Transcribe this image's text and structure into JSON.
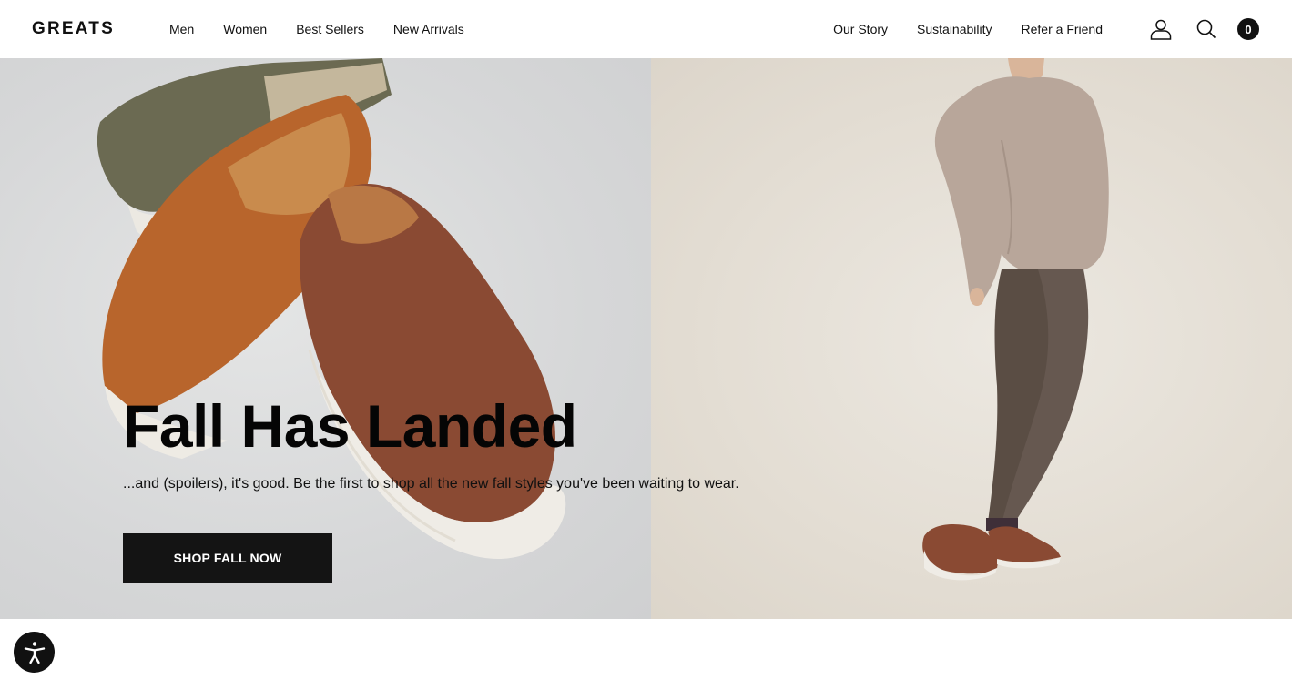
{
  "brand": {
    "logo_text": "GREATS"
  },
  "nav": {
    "left": [
      {
        "label": "Men"
      },
      {
        "label": "Women"
      },
      {
        "label": "Best Sellers"
      },
      {
        "label": "New Arrivals"
      }
    ],
    "right": [
      {
        "label": "Our Story"
      },
      {
        "label": "Sustainability"
      },
      {
        "label": "Refer a Friend"
      }
    ]
  },
  "header_icons": {
    "account": "account-icon",
    "search": "search-icon",
    "cart_count": "0"
  },
  "hero": {
    "title": "Fall Has Landed",
    "subtitle": "...and (spoilers), it's good. Be the first to shop all the new fall styles you've been waiting to wear.",
    "cta_label": "SHOP FALL NOW",
    "left_image": "slip-on-sneakers-photo",
    "right_image": "model-wearing-slip-ons-photo"
  },
  "accessibility": {
    "icon": "accessibility-icon"
  },
  "colors": {
    "text": "#111111",
    "cta_bg": "#141414",
    "left_panel_bg": "#d6d7d8",
    "right_panel_bg": "#e3ddd3",
    "suede": "#b8652c",
    "leather": "#8a4a33",
    "olive": "#6b6a52",
    "sweater": "#b8a69a",
    "trousers": "#5a4d44"
  }
}
